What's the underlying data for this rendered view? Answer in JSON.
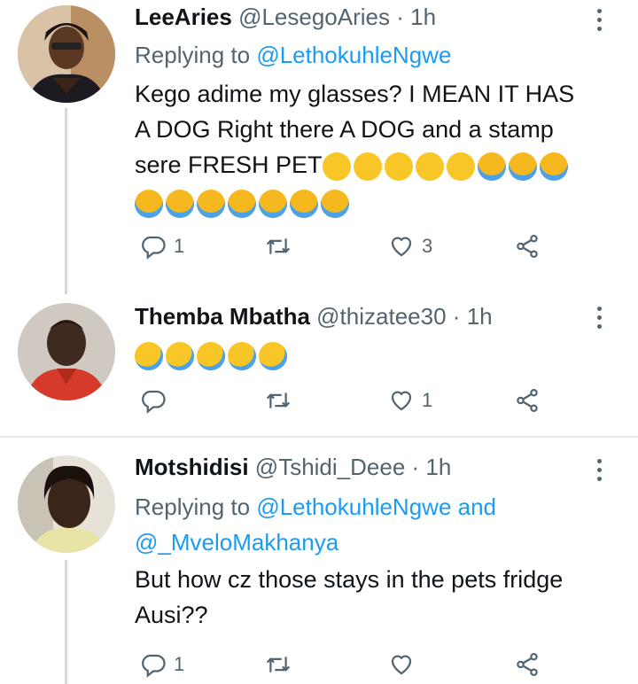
{
  "tweets": [
    {
      "name": "LeeAries",
      "handle": "@LesegoAries",
      "dot": "·",
      "time": "1h",
      "replying_prefix": "Replying to",
      "replying_to": "@LethokuhleNgwe",
      "replying_to_2": "",
      "text_line1": "Kego adime my glasses? I MEAN  IT HAS",
      "text_line2": "A DOG Right there A DOG and a stamp",
      "text_line3": "sere FRESH PET",
      "emoji": [
        "face-with-tears-of-joy",
        "face-with-tears-of-joy",
        "face-with-tears-of-joy",
        "face-with-tears-of-joy",
        "face-with-tears-of-joy",
        "loudly-crying-face",
        "loudly-crying-face",
        "loudly-crying-face",
        "loudly-crying-face",
        "loudly-crying-face",
        "loudly-crying-face",
        "loudly-crying-face",
        "loudly-crying-face",
        "loudly-crying-face",
        "loudly-crying-face"
      ],
      "replies": "1",
      "retweets": "",
      "likes": "3"
    },
    {
      "name": "Themba Mbatha",
      "handle": "@thizatee30",
      "dot": "·",
      "time": "1h",
      "emoji": [
        "rolling-on-the-floor-laughing",
        "rolling-on-the-floor-laughing",
        "rolling-on-the-floor-laughing",
        "rolling-on-the-floor-laughing",
        "rolling-on-the-floor-laughing"
      ],
      "replies": "",
      "retweets": "",
      "likes": "1"
    },
    {
      "name": "Motshidisi",
      "handle": "@Tshidi_Deee",
      "dot": "·",
      "time": "1h",
      "replying_prefix": "Replying to",
      "replying_to": "@LethokuhleNgwe",
      "replying_and": "and",
      "replying_to_2": "@_MveloMakhanya",
      "text_line1": "But how cz those stays in the pets fridge",
      "text_line2": "Ausi??",
      "replies": "1",
      "retweets": "",
      "likes": ""
    }
  ],
  "colors": {
    "link": "#1d9bf0",
    "muted": "#536471",
    "text": "#0f1419",
    "divider": "#e7e9ea",
    "thread_line": "#cfd9de"
  },
  "icons": [
    "reply-icon",
    "retweet-icon",
    "like-icon",
    "share-icon",
    "more-icon"
  ]
}
